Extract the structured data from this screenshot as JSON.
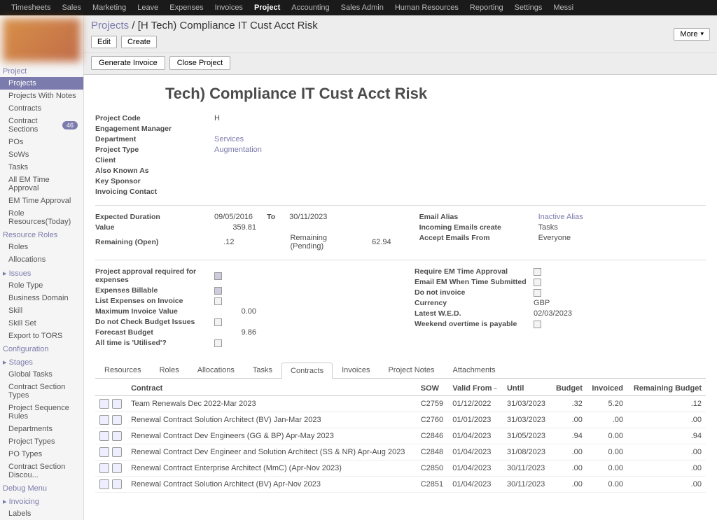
{
  "topnav": [
    "Timesheets",
    "Sales",
    "Marketing",
    "Leave",
    "Expenses",
    "Invoices",
    "Project",
    "Accounting",
    "Sales Admin",
    "Human Resources",
    "Reporting",
    "Settings",
    "Messi"
  ],
  "topnav_active": "Project",
  "breadcrumb": {
    "root": "Projects",
    "current": "[H            Tech) Compliance IT Cust Acct Risk"
  },
  "toolbar": {
    "edit": "Edit",
    "create": "Create",
    "more": "More",
    "gen_invoice": "Generate Invoice",
    "close_proj": "Close Project"
  },
  "sidebar": {
    "sections": [
      {
        "title": "Project",
        "items": [
          {
            "label": "Projects",
            "active": true
          },
          {
            "label": "Projects With Notes"
          },
          {
            "label": "Contracts"
          },
          {
            "label": "Contract Sections",
            "badge": "46"
          },
          {
            "label": "POs"
          },
          {
            "label": "SoWs"
          },
          {
            "label": "Tasks"
          },
          {
            "label": "All EM Time Approval"
          },
          {
            "label": "EM Time Approval"
          },
          {
            "label": "Role Resources(Today)"
          }
        ]
      },
      {
        "title": "Resource Roles",
        "items": [
          {
            "label": "Roles"
          },
          {
            "label": "Allocations"
          }
        ]
      },
      {
        "title": "Issues",
        "expandable": true,
        "items": [
          {
            "label": "Role Type"
          },
          {
            "label": "Business Domain"
          },
          {
            "label": "Skill"
          },
          {
            "label": "Skill Set"
          },
          {
            "label": "Export to TORS"
          }
        ]
      },
      {
        "title": "Configuration",
        "items": []
      },
      {
        "title": "Stages",
        "expandable": true,
        "items": [
          {
            "label": "Global Tasks"
          },
          {
            "label": "Contract Section Types"
          },
          {
            "label": "Project Sequence Rules"
          },
          {
            "label": "Departments"
          },
          {
            "label": "Project Types"
          },
          {
            "label": "PO Types"
          },
          {
            "label": "Contract Section Discou..."
          }
        ]
      },
      {
        "title": "Debug Menu",
        "items": []
      },
      {
        "title": "Invoicing",
        "expandable": true,
        "items": [
          {
            "label": "Labels"
          }
        ]
      }
    ]
  },
  "page": {
    "title": "Tech) Compliance IT Cust Acct Risk",
    "fields_left1": [
      {
        "label": "Project Code",
        "value": "H"
      },
      {
        "label": "Engagement Manager",
        "value": ""
      },
      {
        "label": "Department",
        "value": "Services",
        "link": true
      },
      {
        "label": "Project Type",
        "value": "Augmentation",
        "link": true
      },
      {
        "label": "Client",
        "value": ""
      },
      {
        "label": "Also Known As",
        "value": ""
      },
      {
        "label": "Key Sponsor",
        "value": ""
      },
      {
        "label": "Invoicing Contact",
        "value": ""
      }
    ],
    "duration": {
      "label": "Expected Duration",
      "from": "09/05/2016",
      "to_label": "To",
      "to": "30/11/2023"
    },
    "value": {
      "label": "Value",
      "amount": "359.81"
    },
    "remaining": {
      "label": "Remaining (Open)",
      "amount": ".12",
      "pending_label": "Remaining (Pending)",
      "pending": "62.94"
    },
    "right2": [
      {
        "label": "Email Alias",
        "value": "Inactive Alias",
        "link": true
      },
      {
        "label": "Incoming Emails create",
        "value": "Tasks"
      },
      {
        "label": "Accept Emails From",
        "value": "Everyone"
      }
    ],
    "left3": [
      {
        "label": "Project approval required for expenses",
        "type": "check",
        "checked": true
      },
      {
        "label": "Expenses Billable",
        "type": "check",
        "checked": true
      },
      {
        "label": "List Expenses on Invoice",
        "type": "check",
        "checked": false
      },
      {
        "label": "Maximum Invoice Value",
        "value": "0.00"
      },
      {
        "label": "Do not Check Budget Issues",
        "type": "check",
        "checked": false
      },
      {
        "label": "Forecast Budget",
        "value": "9.86"
      },
      {
        "label": "All time is 'Utilised'?",
        "type": "check",
        "checked": false
      }
    ],
    "right3": [
      {
        "label": "Require EM Time Approval",
        "type": "check",
        "checked": false
      },
      {
        "label": "Email EM When Time Submitted",
        "type": "check",
        "checked": false
      },
      {
        "label": "Do not invoice",
        "type": "check",
        "checked": false
      },
      {
        "label": "Currency",
        "value": "GBP"
      },
      {
        "label": "Latest W.E.D.",
        "value": "02/03/2023"
      },
      {
        "label": "Weekend overtime is payable",
        "type": "check",
        "checked": false
      }
    ]
  },
  "tabs": [
    "Resources",
    "Roles",
    "Allocations",
    "Tasks",
    "Contracts",
    "Invoices",
    "Project Notes",
    "Attachments"
  ],
  "active_tab": "Contracts",
  "table": {
    "headers": [
      "",
      "Contract",
      "SOW",
      "Valid From",
      "Until",
      "Budget",
      "Invoiced",
      "Remaining Budget"
    ],
    "sort_col": 3,
    "rows": [
      {
        "contract": "Team Renewals Dec 2022-Mar 2023",
        "sow": "C2759",
        "from": "01/12/2022",
        "until": "31/03/2023",
        "budget": ".32",
        "invoiced": "5.20",
        "remaining": ".12"
      },
      {
        "contract": "Renewal Contract Solution Architect (BV) Jan-Mar 2023",
        "sow": "C2760",
        "from": "01/01/2023",
        "until": "31/03/2023",
        "budget": ".00",
        "invoiced": ".00",
        "remaining": ".00"
      },
      {
        "contract": "Renewal Contract Dev Engineers (GG & BP) Apr-May 2023",
        "sow": "C2846",
        "from": "01/04/2023",
        "until": "31/05/2023",
        "budget": ".94",
        "invoiced": "0.00",
        "remaining": ".94"
      },
      {
        "contract": "Renewal Contract Dev Engineer and Solution Architect (SS & NR) Apr-Aug 2023",
        "sow": "C2848",
        "from": "01/04/2023",
        "until": "31/08/2023",
        "budget": ".00",
        "invoiced": "0.00",
        "remaining": ".00"
      },
      {
        "contract": "Renewal Contract Enterprise Architect (MmC) (Apr-Nov 2023)",
        "sow": "C2850",
        "from": "01/04/2023",
        "until": "30/11/2023",
        "budget": ".00",
        "invoiced": "0.00",
        "remaining": ".00"
      },
      {
        "contract": "Renewal Contract Solution Architect (BV) Apr-Nov 2023",
        "sow": "C2851",
        "from": "01/04/2023",
        "until": "30/11/2023",
        "budget": ".00",
        "invoiced": "0.00",
        "remaining": ".00"
      }
    ]
  }
}
